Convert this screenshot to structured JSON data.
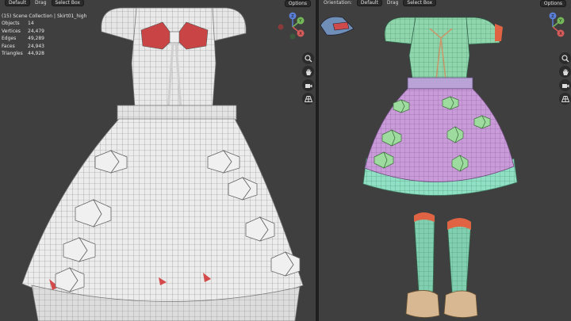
{
  "left_viewport": {
    "header": {
      "mode_label": "Default",
      "drag_label": "Drag",
      "select_label": "Select Box",
      "options_label": "Options"
    },
    "stats": {
      "collection": "(15) Scene Collection | Skirt01_high",
      "rows": [
        {
          "label": "Objects",
          "value": "14"
        },
        {
          "label": "Vertices",
          "value": "24,479"
        },
        {
          "label": "Edges",
          "value": "49,289"
        },
        {
          "label": "Faces",
          "value": "24,943"
        },
        {
          "label": "Triangles",
          "value": "44,928"
        }
      ]
    },
    "gizmo_axes": {
      "z": "Z",
      "y": "Y",
      "x": "X"
    }
  },
  "right_viewport": {
    "header": {
      "orientation_label": "Orientation:",
      "mode_label": "Default",
      "drag_label": "Drag",
      "select_label": "Select Box",
      "options_label": "Options"
    },
    "gizmo_axes": {
      "z": "Z",
      "y": "Y",
      "x": "X"
    }
  },
  "tool_icons": [
    "zoom-icon",
    "hand-pan-icon",
    "camera-icon",
    "perspective-grid-icon"
  ],
  "colors": {
    "viewport_bg": "#3f3f3f",
    "wire_cloth": "#e8e8e8",
    "accent_red": "#d44a4a",
    "mint": "#7fcfa8",
    "lilac": "#c79bd4",
    "shoe": "#d8b892"
  }
}
